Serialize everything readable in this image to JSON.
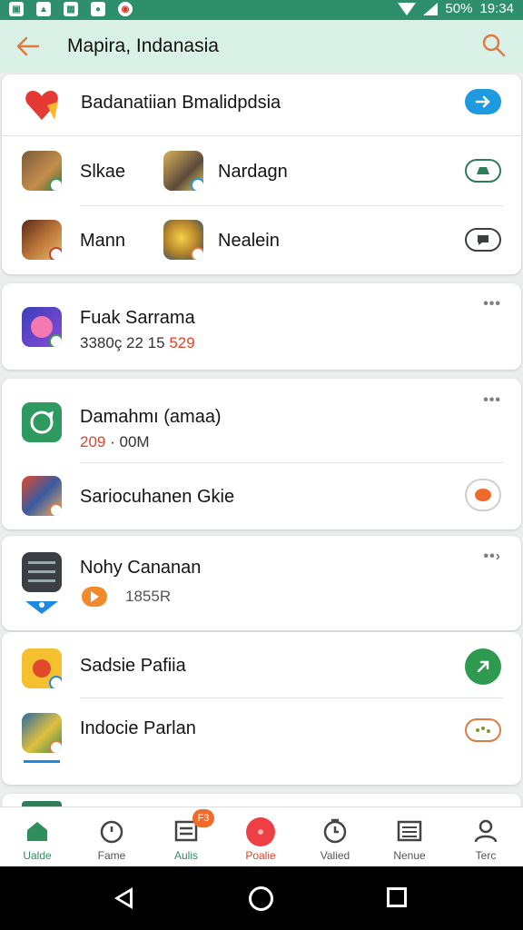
{
  "status_bar": {
    "battery": "50%",
    "time": "19:34"
  },
  "header": {
    "title": "Mapira, Indanasia"
  },
  "cards": {
    "banner": {
      "label": "Badanatiian Bmalidpdsia"
    },
    "games": {
      "row1": {
        "left_name": "Slkae",
        "right_name": "Nardagn"
      },
      "row2": {
        "left_name": "Mann",
        "right_name": "Nealein"
      }
    },
    "card2": {
      "title": "Fuak Sarrama",
      "sub_prefix": "3380ç 22 15",
      "sub_red": "529"
    },
    "card3": {
      "row1_title": "Damahmı (amaa)",
      "row1_sub_red": "209",
      "row1_sub": "· 00M",
      "row2_title": "Sariocuhanen Gkie"
    },
    "card4": {
      "title": "Nohy Cananan",
      "sub": "1855R"
    },
    "card5": {
      "row1_title": "Sadsie Pafiia",
      "row2_title": "Indocie Parlan"
    }
  },
  "bottom_nav": {
    "items": [
      {
        "label": "Ualde"
      },
      {
        "label": "Fame"
      },
      {
        "label": "Aulis"
      },
      {
        "label": "Poalie"
      },
      {
        "label": "Valied"
      },
      {
        "label": "Nenue"
      },
      {
        "label": "Terc"
      }
    ],
    "badge": "F3"
  },
  "colors": {
    "accent_green": "#2e8f6c",
    "header_bg": "#d9f1e6",
    "accent_orange": "#e07a40",
    "alert_red": "#e2432b",
    "button_blue": "#1e9be0"
  }
}
